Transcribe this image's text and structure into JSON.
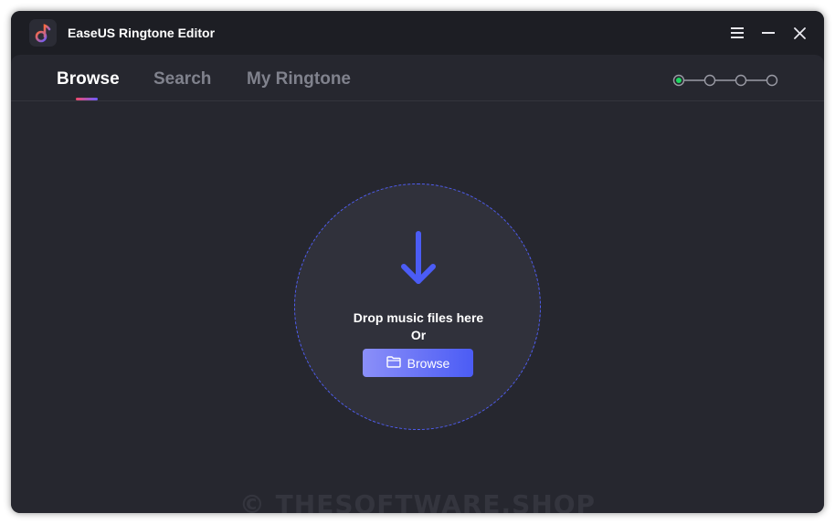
{
  "titlebar": {
    "title": "EaseUS Ringtone Editor",
    "logo_icon": "music-note-icon",
    "menu_icon": "hamburger-menu-icon",
    "minimize_icon": "minimize-icon",
    "close_icon": "close-icon"
  },
  "tabs": [
    {
      "label": "Browse",
      "active": true
    },
    {
      "label": "Search",
      "active": false
    },
    {
      "label": "My Ringtone",
      "active": false
    }
  ],
  "steps": {
    "total": 4,
    "current": 1,
    "active_color": "#1ed760"
  },
  "dropzone": {
    "message": "Drop music files here",
    "or_text": "Or",
    "browse_label": "Browse",
    "arrow_icon": "arrow-down-icon",
    "folder_icon": "folder-icon"
  },
  "watermark": "© THESOFTWARE.SHOP",
  "colors": {
    "accent": "#4f5df3",
    "background": "#1d1e24",
    "panel": "#26272f"
  }
}
